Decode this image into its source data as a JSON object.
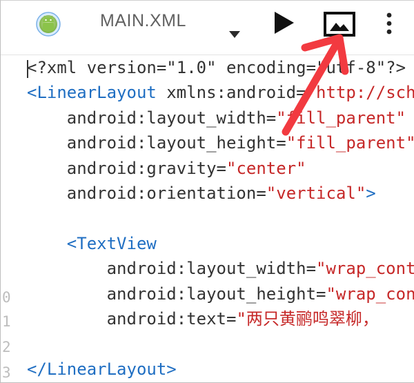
{
  "toolbar": {
    "file_title": "MAIN.XML",
    "app_icon": "android-icon",
    "dropdown_icon": "caret-down-icon",
    "run_icon": "play-icon",
    "preview_icon": "image-icon",
    "more_icon": "more-vertical-icon"
  },
  "editor": {
    "line_numbers": [
      "0",
      "1",
      "2",
      "3"
    ],
    "lines": [
      [
        {
          "t": "p",
          "v": "<?xml version=\"1.0\" encoding=\"utf-8\"?>"
        }
      ],
      [
        {
          "t": "tag",
          "v": "<LinearLayout"
        },
        {
          "t": "attr",
          "v": " xmlns:android"
        },
        {
          "t": "eq",
          "v": "="
        },
        {
          "t": "str",
          "v": "\"http://schemas.android.com/apk/res/android\""
        }
      ],
      [
        {
          "t": "attr",
          "v": "    android:layout_width"
        },
        {
          "t": "eq",
          "v": "="
        },
        {
          "t": "str",
          "v": "\"fill_parent\""
        }
      ],
      [
        {
          "t": "attr",
          "v": "    android:layout_height"
        },
        {
          "t": "eq",
          "v": "="
        },
        {
          "t": "str",
          "v": "\"fill_parent\""
        }
      ],
      [
        {
          "t": "attr",
          "v": "    android:gravity"
        },
        {
          "t": "eq",
          "v": "="
        },
        {
          "t": "str",
          "v": "\"center\""
        }
      ],
      [
        {
          "t": "attr",
          "v": "    android:orientation"
        },
        {
          "t": "eq",
          "v": "="
        },
        {
          "t": "str",
          "v": "\"vertical\""
        },
        {
          "t": "tag",
          "v": ">"
        }
      ],
      [
        {
          "t": "p",
          "v": ""
        }
      ],
      [
        {
          "t": "tag",
          "v": "    <TextView"
        }
      ],
      [
        {
          "t": "attr",
          "v": "        android:layout_width"
        },
        {
          "t": "eq",
          "v": "="
        },
        {
          "t": "str",
          "v": "\"wrap_content\""
        }
      ],
      [
        {
          "t": "attr",
          "v": "        android:layout_height"
        },
        {
          "t": "eq",
          "v": "="
        },
        {
          "t": "str",
          "v": "\"wrap_content\""
        }
      ],
      [
        {
          "t": "attr",
          "v": "        android:text"
        },
        {
          "t": "eq",
          "v": "="
        },
        {
          "t": "str",
          "v": "\"两只黄鹂鸣翠柳，"
        }
      ],
      [
        {
          "t": "p",
          "v": ""
        }
      ],
      [
        {
          "t": "tag",
          "v": "</LinearLayout>"
        }
      ]
    ]
  },
  "colors": {
    "tag": "#1f6ec2",
    "string": "#c62828",
    "text": "#333333",
    "annotation_arrow": "#f23a40"
  }
}
